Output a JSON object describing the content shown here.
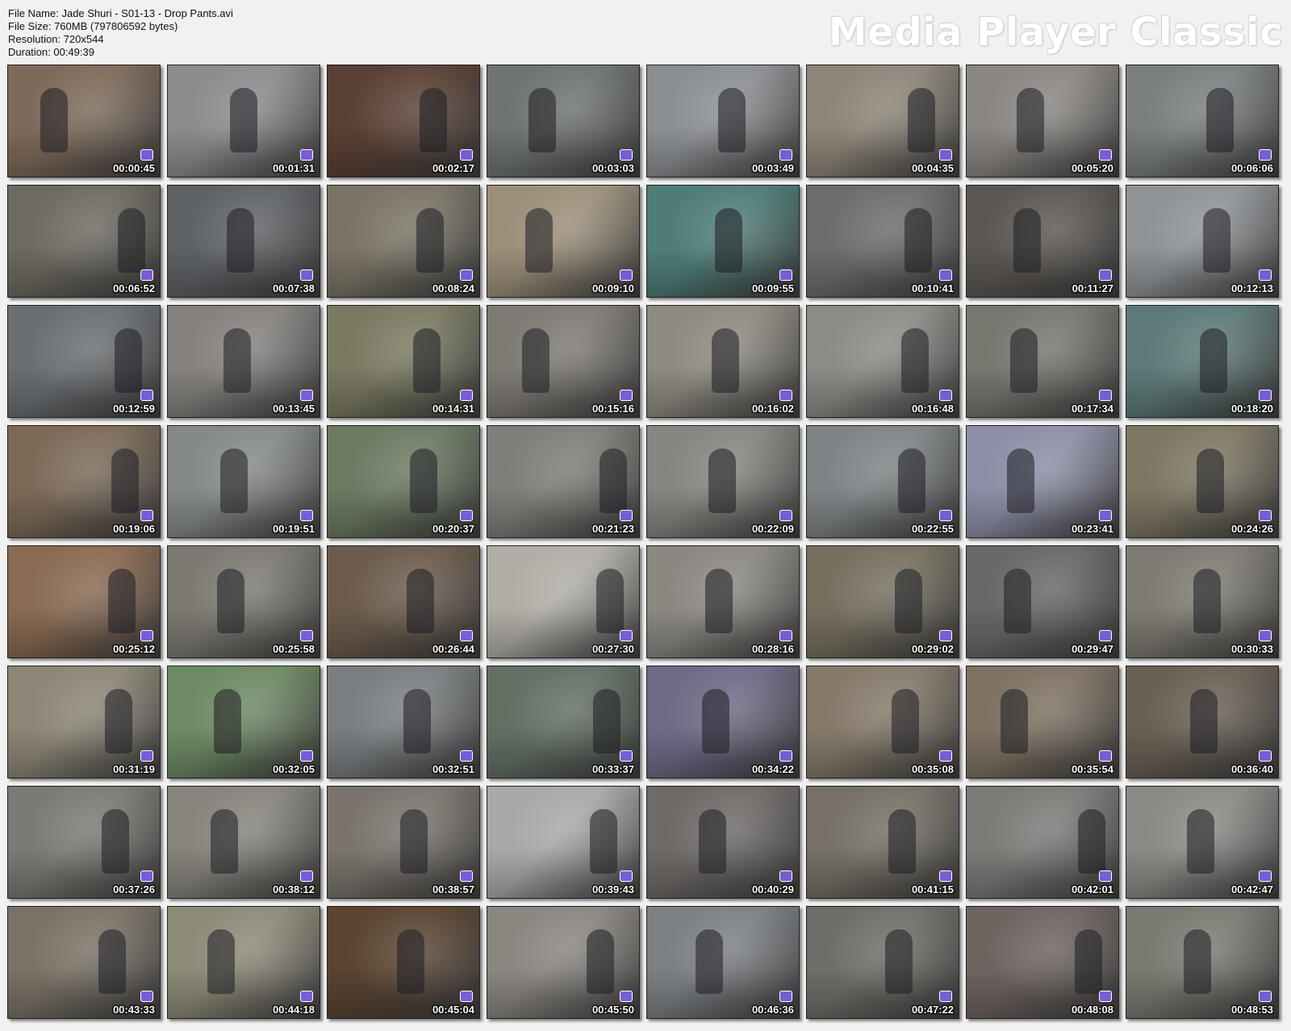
{
  "header": {
    "file_name": "File Name: Jade Shuri - S01-13 - Drop Pants.avi",
    "file_size": "File Size: 760MB (797806592 bytes)",
    "resolution": "Resolution: 720x544",
    "duration": "Duration: 00:49:39",
    "brand": "Media Player Classic"
  },
  "thumbnails": [
    {
      "time": "00:00:45",
      "color": "#7d6a5a"
    },
    {
      "time": "00:01:31",
      "color": "#8a8c8e"
    },
    {
      "time": "00:02:17",
      "color": "#5a4034"
    },
    {
      "time": "00:03:03",
      "color": "#6f7470"
    },
    {
      "time": "00:03:49",
      "color": "#8c8f92"
    },
    {
      "time": "00:04:35",
      "color": "#8d8578"
    },
    {
      "time": "00:05:20",
      "color": "#8a8682"
    },
    {
      "time": "00:06:06",
      "color": "#7b7f80"
    },
    {
      "time": "00:06:52",
      "color": "#6d6a60"
    },
    {
      "time": "00:07:38",
      "color": "#5f6266"
    },
    {
      "time": "00:08:24",
      "color": "#7a7466"
    },
    {
      "time": "00:09:10",
      "color": "#9c8f7a"
    },
    {
      "time": "00:09:55",
      "color": "#4e7d78"
    },
    {
      "time": "00:10:41",
      "color": "#6e6d6c"
    },
    {
      "time": "00:11:27",
      "color": "#5c5752"
    },
    {
      "time": "00:12:13",
      "color": "#8f9396"
    },
    {
      "time": "00:12:59",
      "color": "#6b6f72"
    },
    {
      "time": "00:13:45",
      "color": "#84817e"
    },
    {
      "time": "00:14:31",
      "color": "#7a7a62"
    },
    {
      "time": "00:15:16",
      "color": "#7e7a74"
    },
    {
      "time": "00:16:02",
      "color": "#8e8a80"
    },
    {
      "time": "00:16:48",
      "color": "#8a8c86"
    },
    {
      "time": "00:17:34",
      "color": "#76776f"
    },
    {
      "time": "00:18:20",
      "color": "#5d7a78"
    },
    {
      "time": "00:19:06",
      "color": "#7c6a58"
    },
    {
      "time": "00:19:51",
      "color": "#858a88"
    },
    {
      "time": "00:20:37",
      "color": "#6c7a62"
    },
    {
      "time": "00:21:23",
      "color": "#7c8078"
    },
    {
      "time": "00:22:09",
      "color": "#878580"
    },
    {
      "time": "00:22:55",
      "color": "#7f8486"
    },
    {
      "time": "00:23:41",
      "color": "#8c8fa6"
    },
    {
      "time": "00:24:26",
      "color": "#7e7764"
    },
    {
      "time": "00:25:12",
      "color": "#8a6a52"
    },
    {
      "time": "00:25:58",
      "color": "#7c7a72"
    },
    {
      "time": "00:26:44",
      "color": "#6c5b4c"
    },
    {
      "time": "00:27:30",
      "color": "#b0ada6"
    },
    {
      "time": "00:28:16",
      "color": "#8b8882"
    },
    {
      "time": "00:29:02",
      "color": "#76705f"
    },
    {
      "time": "00:29:47",
      "color": "#6a6866"
    },
    {
      "time": "00:30:33",
      "color": "#7e7b72"
    },
    {
      "time": "00:31:19",
      "color": "#8c8676"
    },
    {
      "time": "00:32:05",
      "color": "#6e8a64"
    },
    {
      "time": "00:32:51",
      "color": "#7a7e80"
    },
    {
      "time": "00:33:37",
      "color": "#627064"
    },
    {
      "time": "00:34:22",
      "color": "#6f6a86"
    },
    {
      "time": "00:35:08",
      "color": "#857a6a"
    },
    {
      "time": "00:35:54",
      "color": "#7e7262"
    },
    {
      "time": "00:36:40",
      "color": "#6a6054"
    },
    {
      "time": "00:37:26",
      "color": "#7c7a74"
    },
    {
      "time": "00:38:12",
      "color": "#86847c"
    },
    {
      "time": "00:38:57",
      "color": "#7a746c"
    },
    {
      "time": "00:39:43",
      "color": "#a8a8a6"
    },
    {
      "time": "00:40:29",
      "color": "#6e6a68"
    },
    {
      "time": "00:41:15",
      "color": "#767066"
    },
    {
      "time": "00:42:01",
      "color": "#7a7c78"
    },
    {
      "time": "00:42:47",
      "color": "#8a8a86"
    },
    {
      "time": "00:43:33",
      "color": "#7a7266"
    },
    {
      "time": "00:44:18",
      "color": "#8e8a78"
    },
    {
      "time": "00:45:04",
      "color": "#5a4432"
    },
    {
      "time": "00:45:50",
      "color": "#8a8680"
    },
    {
      "time": "00:46:36",
      "color": "#7c8084"
    },
    {
      "time": "00:47:22",
      "color": "#6f6e68"
    },
    {
      "time": "00:48:08",
      "color": "#6e6460"
    },
    {
      "time": "00:48:53",
      "color": "#7a7a72"
    }
  ]
}
